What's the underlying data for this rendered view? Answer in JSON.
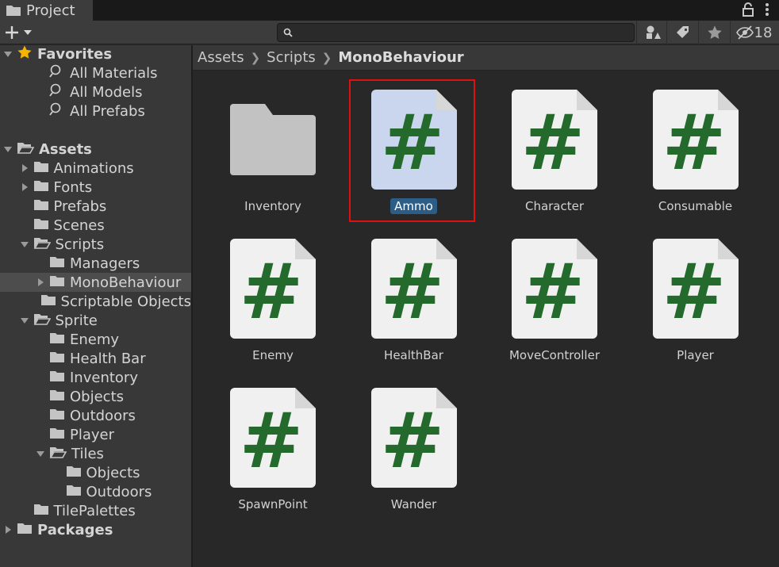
{
  "tab": {
    "title": "Project",
    "icon": "folder-icon"
  },
  "toolbar": {
    "create_icon": "plus-icon",
    "search_placeholder": "",
    "hidden_count": "18"
  },
  "tree": [
    {
      "label": "Favorites",
      "bold": true,
      "indent": 0,
      "arrow": "down",
      "icon": "star"
    },
    {
      "label": "All Materials",
      "indent": 2,
      "icon": "search"
    },
    {
      "label": "All Models",
      "indent": 2,
      "icon": "search"
    },
    {
      "label": "All Prefabs",
      "indent": 2,
      "icon": "search"
    },
    {
      "label": "",
      "indent": 0,
      "icon": "none"
    },
    {
      "label": "Assets",
      "bold": true,
      "indent": 0,
      "arrow": "down",
      "icon": "open"
    },
    {
      "label": "Animations",
      "indent": 1,
      "arrow": "right",
      "icon": "folder"
    },
    {
      "label": "Fonts",
      "indent": 1,
      "arrow": "right",
      "icon": "folder"
    },
    {
      "label": "Prefabs",
      "indent": 1,
      "icon": "folder"
    },
    {
      "label": "Scenes",
      "indent": 1,
      "icon": "folder"
    },
    {
      "label": "Scripts",
      "indent": 1,
      "arrow": "down",
      "icon": "open"
    },
    {
      "label": "Managers",
      "indent": 2,
      "icon": "folder"
    },
    {
      "label": "MonoBehaviour",
      "indent": 2,
      "arrow": "right",
      "icon": "folder",
      "selected": true
    },
    {
      "label": "Scriptable Objects",
      "indent": 2,
      "icon": "folder"
    },
    {
      "label": "Sprite",
      "indent": 1,
      "arrow": "down",
      "icon": "open"
    },
    {
      "label": "Enemy",
      "indent": 2,
      "icon": "folder"
    },
    {
      "label": "Health Bar",
      "indent": 2,
      "icon": "folder"
    },
    {
      "label": "Inventory",
      "indent": 2,
      "icon": "folder"
    },
    {
      "label": "Objects",
      "indent": 2,
      "icon": "folder"
    },
    {
      "label": "Outdoors",
      "indent": 2,
      "icon": "folder"
    },
    {
      "label": "Player",
      "indent": 2,
      "icon": "folder"
    },
    {
      "label": "Tiles",
      "indent": 2,
      "arrow": "down",
      "icon": "open"
    },
    {
      "label": "Objects",
      "indent": 3,
      "icon": "folder"
    },
    {
      "label": "Outdoors",
      "indent": 3,
      "icon": "folder"
    },
    {
      "label": "TilePalettes",
      "indent": 1,
      "icon": "folder"
    },
    {
      "label": "Packages",
      "bold": true,
      "indent": 0,
      "arrow": "right",
      "icon": "folder"
    }
  ],
  "breadcrumb": [
    "Assets",
    "Scripts",
    "MonoBehaviour"
  ],
  "assets": [
    {
      "name": "Inventory",
      "type": "folder"
    },
    {
      "name": "Ammo",
      "type": "script",
      "selected": true
    },
    {
      "name": "Character",
      "type": "script"
    },
    {
      "name": "Consumable",
      "type": "script"
    },
    {
      "name": "Enemy",
      "type": "script"
    },
    {
      "name": "HealthBar",
      "type": "script"
    },
    {
      "name": "MoveController",
      "type": "script"
    },
    {
      "name": "Player",
      "type": "script"
    },
    {
      "name": "SpawnPoint",
      "type": "script"
    },
    {
      "name": "Wander",
      "type": "script"
    }
  ],
  "colors": {
    "script_glyph": "#246a2c",
    "script_page": "#f0f0f0",
    "script_page_selected": "#c9d6ee",
    "selection": "#2c5d87",
    "highlight_box": "#e01010"
  }
}
